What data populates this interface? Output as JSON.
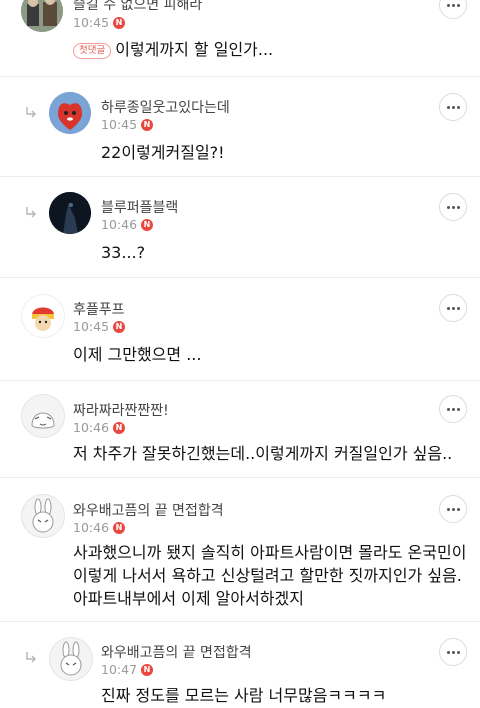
{
  "comments": [
    {
      "nick": "슬길 수 없으면 피해라",
      "time": "10:45",
      "badge": "첫댓글",
      "text": "이렇게까지 할 일인가..."
    },
    {
      "nick": "하루종일웃고있다는데",
      "time": "10:45",
      "text": "22이렇게커질일?!"
    },
    {
      "nick": "블루퍼플블랙",
      "time": "10:46",
      "text": "33...?"
    },
    {
      "nick": "후플푸프",
      "time": "10:45",
      "text": "이제 그만했으면 ..."
    },
    {
      "nick": "짜라짜라짠짠짠!",
      "time": "10:46",
      "text": "저 차주가 잘못하긴했는데..이렇게까지 커질일인가 싶음.."
    },
    {
      "nick": "와우배고픔의 끝 면접합격",
      "time": "10:46",
      "lines": [
        "사과했으니까 됐지 솔직히 아파트사람이면 몰라도 온국민이",
        "이렇게 나서서 욕하고 신상털려고 할만한 짓까지인가 싶음.",
        "아파트내부에서 이제 알아서하겠지"
      ]
    },
    {
      "nick": "와우배고픔의 끝 면접합격",
      "time": "10:47",
      "text": "진짜 정도를 모르는 사람 너무많음ㅋㅋㅋㅋ"
    }
  ],
  "new_badge": "N",
  "more_icon": "more-horizontal-icon",
  "reply_icon": "reply-arrow-icon",
  "colors": {
    "new_badge": "#e8483f",
    "first_badge": "#e35a52",
    "divider": "#ececec"
  }
}
